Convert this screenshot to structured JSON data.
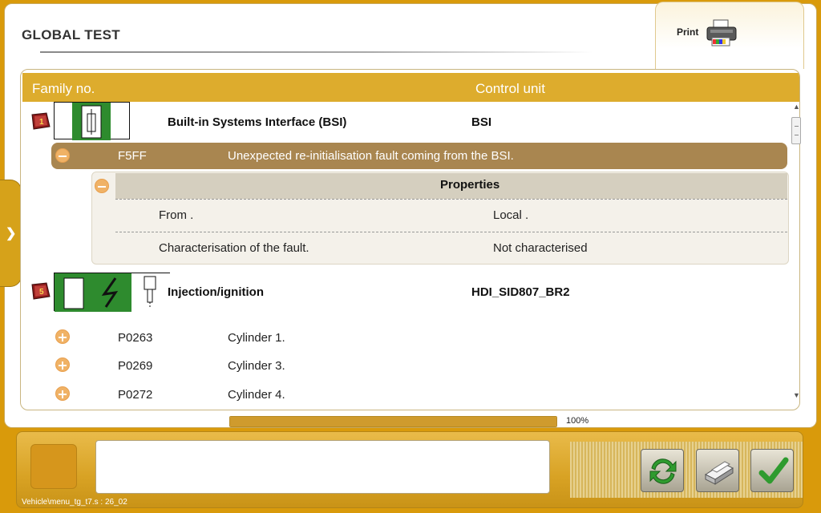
{
  "window": {
    "title": "GLOBAL TEST"
  },
  "print": {
    "label": "Print"
  },
  "table": {
    "headers": {
      "family": "Family no.",
      "control_unit": "Control unit"
    }
  },
  "families": [
    {
      "flag_number": "1",
      "name": "Built-in Systems Interface (BSI)",
      "control_unit": "BSI",
      "faults": [
        {
          "code": "F5FF",
          "description": "Unexpected re-initialisation fault coming from the BSI.",
          "expanded": true,
          "properties": {
            "title": "Properties",
            "rows": [
              {
                "label": "From .",
                "value": "Local ."
              },
              {
                "label": "Characterisation of the fault.",
                "value": "Not characterised"
              }
            ]
          }
        }
      ]
    },
    {
      "flag_number": "5",
      "name": "Injection/ignition",
      "control_unit": "HDI_SID807_BR2",
      "faults": [
        {
          "code": "P0263",
          "description": "Cylinder 1."
        },
        {
          "code": "P0269",
          "description": "Cylinder 3."
        },
        {
          "code": "P0272",
          "description": "Cylinder 4."
        }
      ]
    }
  ],
  "progress": {
    "value": 1.0,
    "label": "100%"
  },
  "footer": {
    "path": "Vehicle\\menu_tg_t7.s : 26_02"
  },
  "colors": {
    "accent": "#DDAC2D",
    "fault_row": "#A98650",
    "background": "#D99A0B"
  }
}
